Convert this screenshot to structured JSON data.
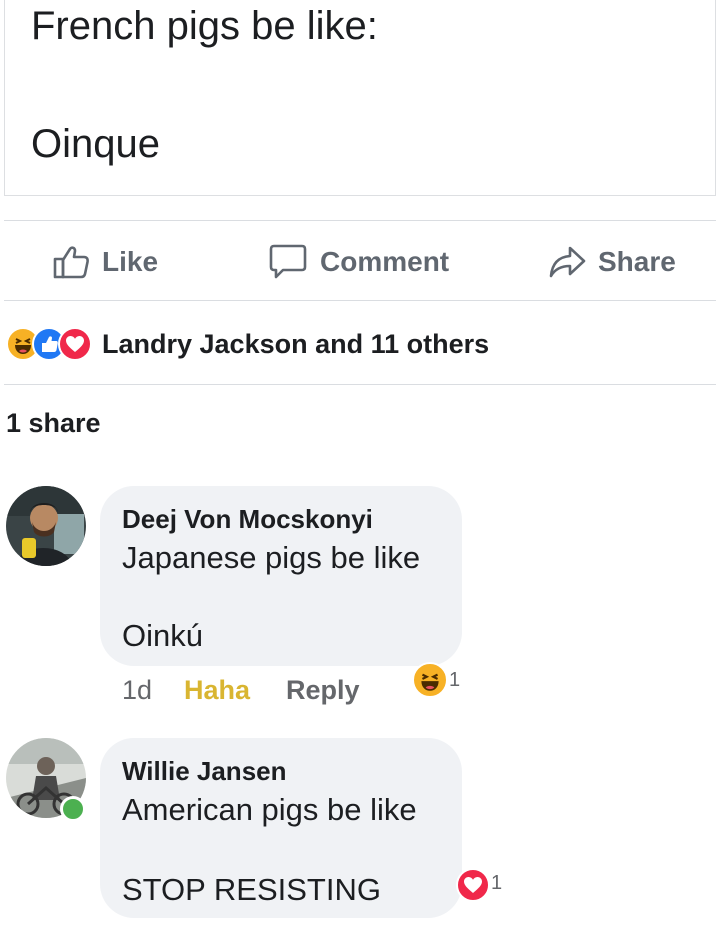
{
  "post": {
    "line1": "French pigs be like:",
    "line2": "Oinque"
  },
  "actions": {
    "like": "Like",
    "comment": "Comment",
    "share": "Share"
  },
  "reactions": {
    "icons": [
      "haha-reaction-icon",
      "like-reaction-icon",
      "love-reaction-icon"
    ],
    "summary": "Landry Jackson and 11 others"
  },
  "shares": "1 share",
  "comments": [
    {
      "author": "Deej Von Mocskonyi",
      "line1": "Japanese pigs be like",
      "line2": "Oinkú",
      "time": "1d",
      "reaction_label": "Haha",
      "reply_label": "Reply",
      "reaction_icon": "haha-reaction-icon",
      "reaction_count": "1"
    },
    {
      "author": "Willie Jansen",
      "line1": "American pigs be like",
      "line2": "STOP RESISTING",
      "reaction_icon": "love-reaction-icon",
      "reaction_count": "1",
      "online": true
    }
  ],
  "colors": {
    "text": "#1c1e21",
    "muted": "#606770",
    "bubble": "#f0f2f5",
    "haha": "#f7b125",
    "like": "#2078f4",
    "love": "#f0284a",
    "haha_label": "#d9b531",
    "online": "#4cb050"
  }
}
